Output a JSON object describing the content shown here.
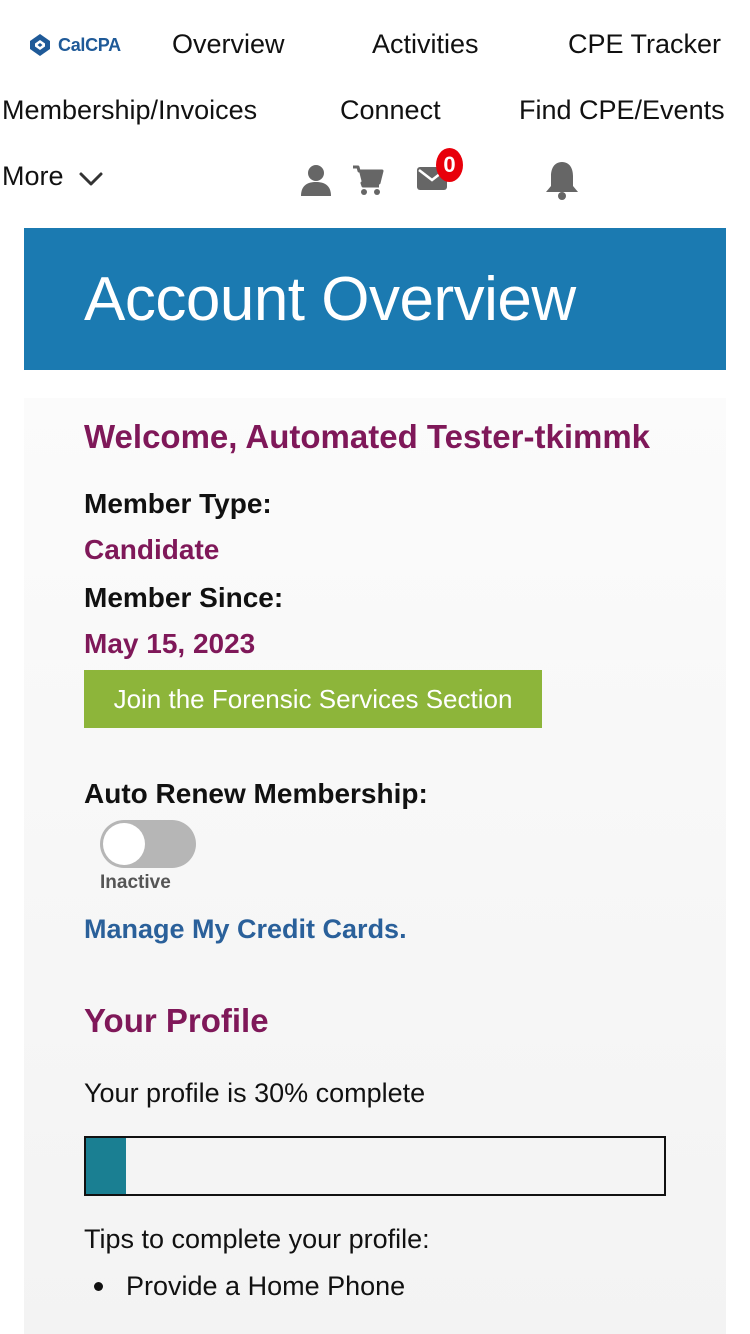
{
  "header": {
    "logo_text": "CalCPA",
    "nav": {
      "overview": "Overview",
      "activities": "Activities",
      "cpe_tracker": "CPE Tracker",
      "membership": "Membership/Invoices",
      "connect": "Connect",
      "find_cpe": "Find CPE/Events",
      "more": "More"
    },
    "message_count": "0",
    "icons": [
      "user-icon",
      "cart-icon",
      "mail-icon",
      "bell-icon",
      "chevron-down-icon"
    ]
  },
  "banner": {
    "title": "Account Overview"
  },
  "account": {
    "welcome": "Welcome, Automated Tester-tkimmk",
    "member_type_label": "Member Type:",
    "member_type_value": "Candidate",
    "member_since_label": "Member Since:",
    "member_since_value": "May 15, 2023",
    "join_button": "Join the Forensic Services Section",
    "auto_renew_label": "Auto Renew Membership:",
    "auto_renew_state": "Inactive",
    "auto_renew_on": false,
    "manage_cards_link": "Manage My Credit Cards."
  },
  "profile": {
    "heading": "Your Profile",
    "completion_text": "Your profile is 30% complete",
    "completion_fraction": 0.07,
    "tips_heading": "Tips to complete your profile:",
    "tips": [
      "Provide a Home Phone"
    ]
  },
  "colors": {
    "banner": "#1b7ab1",
    "accent_maroon": "#7f1859",
    "link_blue": "#2a609a",
    "button_green": "#8db53a",
    "progress_teal": "#1a7f92",
    "badge_red": "#e8000b"
  }
}
